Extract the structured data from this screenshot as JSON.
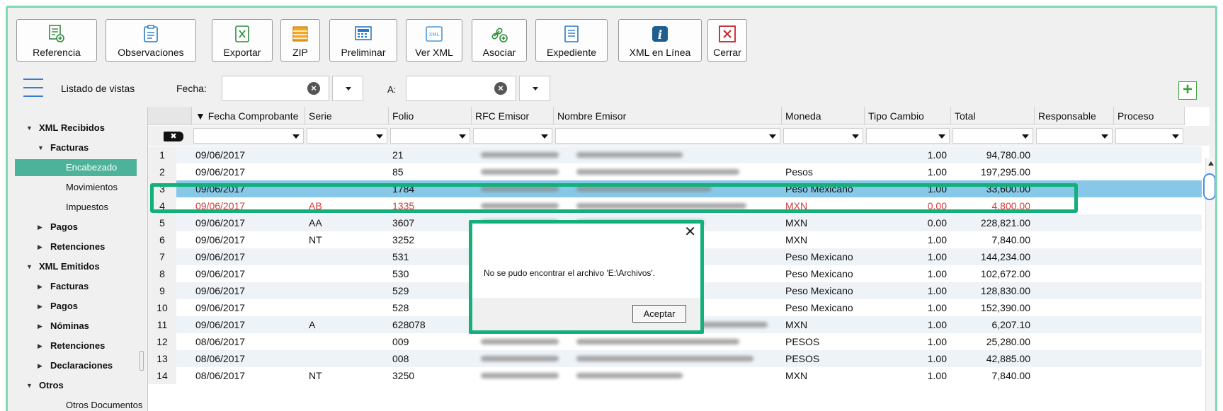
{
  "toolbar": {
    "buttons": [
      {
        "label": "Referencia",
        "icon": "reference-icon"
      },
      {
        "label": "Observaciones",
        "icon": "clipboard-icon"
      },
      {
        "label": "Exportar",
        "icon": "excel-icon"
      },
      {
        "label": "ZIP",
        "icon": "zip-icon"
      },
      {
        "label": "Preliminar",
        "icon": "preview-icon"
      },
      {
        "label": "Ver XML",
        "icon": "xml-file-icon"
      },
      {
        "label": "Asociar",
        "icon": "link-add-icon"
      },
      {
        "label": "Expediente",
        "icon": "document-icon"
      },
      {
        "label": "XML en Línea",
        "icon": "info-icon"
      },
      {
        "label": "Cerrar",
        "icon": "close-icon"
      }
    ]
  },
  "filters": {
    "views_label": "Listado de vistas",
    "date_label": "Fecha:",
    "to_label": "A:",
    "date_from_value": "",
    "date_to_value": ""
  },
  "tree": {
    "items": [
      {
        "label": "XML Recibidos",
        "level": 0,
        "bold": true,
        "arrow": "down"
      },
      {
        "label": "Facturas",
        "level": 1,
        "bold": true,
        "arrow": "down"
      },
      {
        "label": "Encabezado",
        "level": 2,
        "selected": true
      },
      {
        "label": "Movimientos",
        "level": 2
      },
      {
        "label": "Impuestos",
        "level": 2
      },
      {
        "label": "Pagos",
        "level": 1,
        "bold": true,
        "arrow": "right"
      },
      {
        "label": "Retenciones",
        "level": 1,
        "bold": true,
        "arrow": "right"
      },
      {
        "label": "XML Emitidos",
        "level": 0,
        "bold": true,
        "arrow": "down"
      },
      {
        "label": "Facturas",
        "level": 1,
        "bold": true,
        "arrow": "right"
      },
      {
        "label": "Pagos",
        "level": 1,
        "bold": true,
        "arrow": "right"
      },
      {
        "label": "Nóminas",
        "level": 1,
        "bold": true,
        "arrow": "right"
      },
      {
        "label": "Retenciones",
        "level": 1,
        "bold": true,
        "arrow": "right"
      },
      {
        "label": "Declaraciones",
        "level": 1,
        "bold": true,
        "arrow": "right"
      },
      {
        "label": "Otros",
        "level": 0,
        "bold": true,
        "arrow": "down"
      },
      {
        "label": "Otros Documentos",
        "level": 2
      }
    ]
  },
  "grid": {
    "clear_filter_symbol": "✖",
    "columns": [
      "▼ Fecha Comprobante",
      "Serie",
      "Folio",
      "RFC Emisor",
      "Nombre Emisor",
      "Moneda",
      "Tipo Cambio",
      "Total",
      "Responsable",
      "Proceso"
    ],
    "rows": [
      {
        "n": "1",
        "fecha": "09/06/2017",
        "serie": "",
        "folio": "21",
        "moneda": "",
        "tc": "1.00",
        "total": "94,780.00"
      },
      {
        "n": "2",
        "fecha": "09/06/2017",
        "serie": "",
        "folio": "85",
        "moneda": "Pesos",
        "tc": "1.00",
        "total": "197,295.00"
      },
      {
        "n": "3",
        "fecha": "09/06/2017",
        "serie": "",
        "folio": "1784",
        "moneda": "Peso Mexicano",
        "tc": "1.00",
        "total": "33,600.00",
        "selected": true
      },
      {
        "n": "4",
        "fecha": "09/06/2017",
        "serie": "AB",
        "folio": "1335",
        "moneda": "MXN",
        "tc": "0.00",
        "total": "4,800.00",
        "red": true
      },
      {
        "n": "5",
        "fecha": "09/06/2017",
        "serie": "AA",
        "folio": "3607",
        "moneda": "MXN",
        "tc": "0.00",
        "total": "228,821.00"
      },
      {
        "n": "6",
        "fecha": "09/06/2017",
        "serie": "NT",
        "folio": "3252",
        "moneda": "MXN",
        "tc": "1.00",
        "total": "7,840.00"
      },
      {
        "n": "7",
        "fecha": "09/06/2017",
        "serie": "",
        "folio": "531",
        "moneda": "Peso Mexicano",
        "tc": "1.00",
        "total": "144,234.00"
      },
      {
        "n": "8",
        "fecha": "09/06/2017",
        "serie": "",
        "folio": "530",
        "moneda": "Peso Mexicano",
        "tc": "1.00",
        "total": "102,672.00"
      },
      {
        "n": "9",
        "fecha": "09/06/2017",
        "serie": "",
        "folio": "529",
        "moneda": "Peso Mexicano",
        "tc": "1.00",
        "total": "128,830.00"
      },
      {
        "n": "10",
        "fecha": "09/06/2017",
        "serie": "",
        "folio": "528",
        "moneda": "Peso Mexicano",
        "tc": "1.00",
        "total": "152,390.00"
      },
      {
        "n": "11",
        "fecha": "09/06/2017",
        "serie": "A",
        "folio": "628078",
        "moneda": "MXN",
        "tc": "1.00",
        "total": "6,207.10"
      },
      {
        "n": "12",
        "fecha": "08/06/2017",
        "serie": "",
        "folio": "009",
        "moneda": "PESOS",
        "tc": "1.00",
        "total": "25,280.00"
      },
      {
        "n": "13",
        "fecha": "08/06/2017",
        "serie": "",
        "folio": "008",
        "moneda": "PESOS",
        "tc": "1.00",
        "total": "42,885.00"
      },
      {
        "n": "14",
        "fecha": "08/06/2017",
        "serie": "NT",
        "folio": "3250",
        "moneda": "MXN",
        "tc": "1.00",
        "total": "7,840.00"
      }
    ]
  },
  "dialog": {
    "message": "No se pudo encontrar el archivo 'E:\\Archivos'.",
    "ok_label": "Aceptar",
    "close_symbol": "✕"
  },
  "colors": {
    "accent_green": "#14b07a",
    "selected_tree": "#4cb39a",
    "selected_row": "#87c8e8",
    "error_row": "#d23a3a"
  }
}
